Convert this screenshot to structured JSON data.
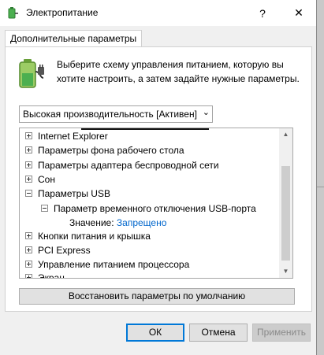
{
  "window": {
    "title": "Электропитание",
    "help_glyph": "?",
    "close_glyph": "✕"
  },
  "tabs": [
    {
      "label": "Дополнительные параметры"
    }
  ],
  "description": {
    "line1": "Выберите схему управления питанием, которую вы",
    "line2": "хотите настроить, а затем задайте нужные параметры."
  },
  "plan_select": {
    "selected": "Высокая производительность [Активен]"
  },
  "tree": {
    "items": [
      {
        "label": "Internet Explorer",
        "state": "collapsed"
      },
      {
        "label": "Параметры фона рабочего стола",
        "state": "collapsed"
      },
      {
        "label": "Параметры адаптера беспроводной сети",
        "state": "collapsed"
      },
      {
        "label": "Сон",
        "state": "collapsed"
      },
      {
        "label": "Параметры USB",
        "state": "expanded"
      },
      {
        "label": "Параметр временного отключения USB-порта",
        "state": "expanded"
      },
      {
        "label": "Кнопки питания и крышка",
        "state": "collapsed"
      },
      {
        "label": "PCI Express",
        "state": "collapsed"
      },
      {
        "label": "Управление питанием процессора",
        "state": "collapsed"
      },
      {
        "label": "Экран",
        "state": "collapsed"
      }
    ],
    "value_label": "Значение:",
    "value": "Запрещено"
  },
  "buttons": {
    "restore": "Восстановить параметры по умолчанию",
    "ok": "ОК",
    "cancel": "Отмена",
    "apply": "Применить"
  },
  "icons": {
    "app": "power-options-icon",
    "panel": "battery-plug-icon"
  }
}
